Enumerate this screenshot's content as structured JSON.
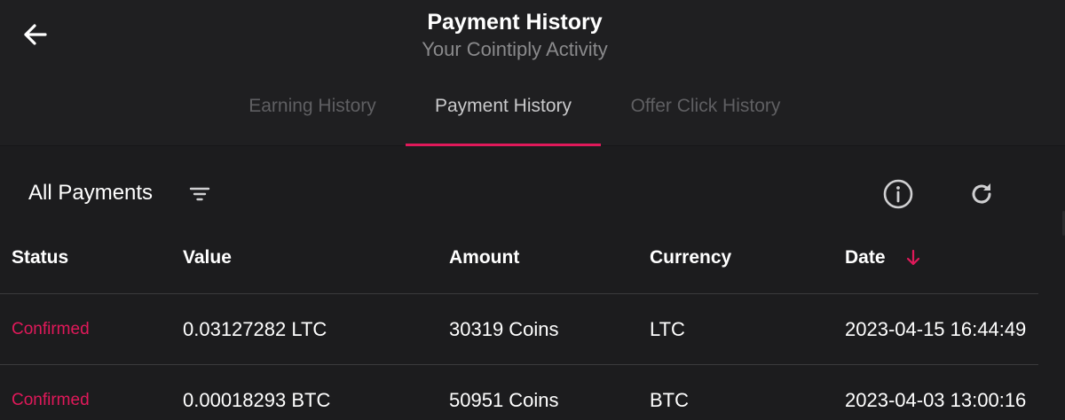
{
  "header": {
    "title": "Payment History",
    "subtitle": "Your Cointiply Activity"
  },
  "tabs": [
    {
      "label": "Earning History",
      "active": false
    },
    {
      "label": "Payment History",
      "active": true
    },
    {
      "label": "Offer Click History",
      "active": false
    }
  ],
  "toolbar": {
    "filter_label": "All Payments"
  },
  "table": {
    "columns": {
      "status": "Status",
      "value": "Value",
      "amount": "Amount",
      "currency": "Currency",
      "date": "Date"
    },
    "rows": [
      {
        "status": "Confirmed",
        "value": "0.03127282 LTC",
        "amount": "30319 Coins",
        "currency": "LTC",
        "date": "2023-04-15 16:44:49"
      },
      {
        "status": "Confirmed",
        "value": "0.00018293 BTC",
        "amount": "50951 Coins",
        "currency": "BTC",
        "date": "2023-04-03 13:00:16"
      }
    ]
  },
  "colors": {
    "background": "#1c1c1e",
    "accent": "#e0195a",
    "muted": "#8a8a8c"
  },
  "icons": {
    "back": "arrow-left-icon",
    "filter": "filter-lines-icon",
    "info": "info-circle-icon",
    "refresh": "refresh-icon",
    "sort": "arrow-down-icon"
  }
}
